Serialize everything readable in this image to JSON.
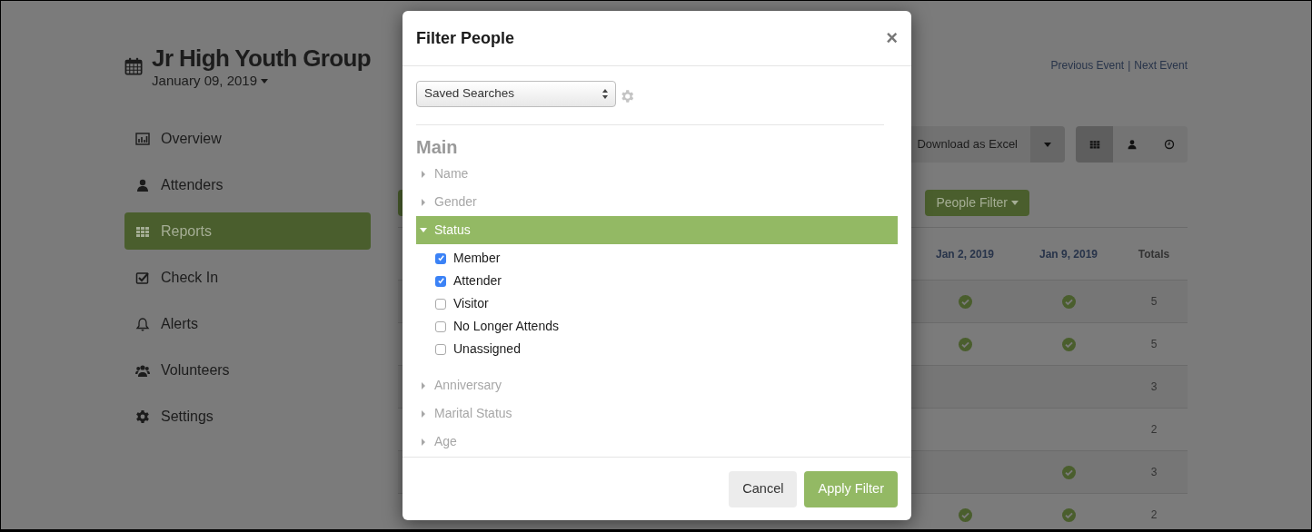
{
  "event": {
    "title": "Jr High Youth Group",
    "date": "January 09, 2019"
  },
  "nav": [
    {
      "label": "Overview",
      "selected": false
    },
    {
      "label": "Attenders",
      "selected": false
    },
    {
      "label": "Reports",
      "selected": true
    },
    {
      "label": "Check In",
      "selected": false
    },
    {
      "label": "Alerts",
      "selected": false
    },
    {
      "label": "Volunteers",
      "selected": false
    },
    {
      "label": "Settings",
      "selected": false
    }
  ],
  "event_links": {
    "previous": "Previous Event",
    "separator": "|",
    "next": "Next Event"
  },
  "toolbar": {
    "download": "Download as Excel",
    "views": [
      {
        "selected": true
      },
      {
        "selected": false
      },
      {
        "selected": false
      }
    ]
  },
  "people_filter": "People Filter",
  "table": {
    "columns": [
      "Jan 2, 2019",
      "Jan 9, 2019",
      "Totals"
    ],
    "rows": [
      {
        "attended": [
          true,
          true
        ],
        "total": "5"
      },
      {
        "attended": [
          true,
          true
        ],
        "total": "5"
      },
      {
        "attended": [
          false,
          false
        ],
        "total": "3"
      },
      {
        "attended": [
          false,
          false
        ],
        "total": "2"
      },
      {
        "attended": [
          false,
          true
        ],
        "total": "3"
      },
      {
        "attended": [
          true,
          true
        ],
        "total": "2"
      }
    ]
  },
  "modal": {
    "title": "Filter People",
    "close": "×",
    "saved_searches": "Saved Searches",
    "section": "Main",
    "groups": [
      {
        "label": "Name",
        "expanded": false
      },
      {
        "label": "Gender",
        "expanded": false
      },
      {
        "label": "Status",
        "expanded": true,
        "options": [
          {
            "label": "Member",
            "checked": true
          },
          {
            "label": "Attender",
            "checked": true
          },
          {
            "label": "Visitor",
            "checked": false
          },
          {
            "label": "No Longer Attends",
            "checked": false
          },
          {
            "label": "Unassigned",
            "checked": false
          }
        ]
      },
      {
        "label": "Anniversary",
        "expanded": false
      },
      {
        "label": "Marital Status",
        "expanded": false
      },
      {
        "label": "Age",
        "expanded": false
      }
    ],
    "buttons": {
      "cancel": "Cancel",
      "apply": "Apply Filter"
    }
  }
}
